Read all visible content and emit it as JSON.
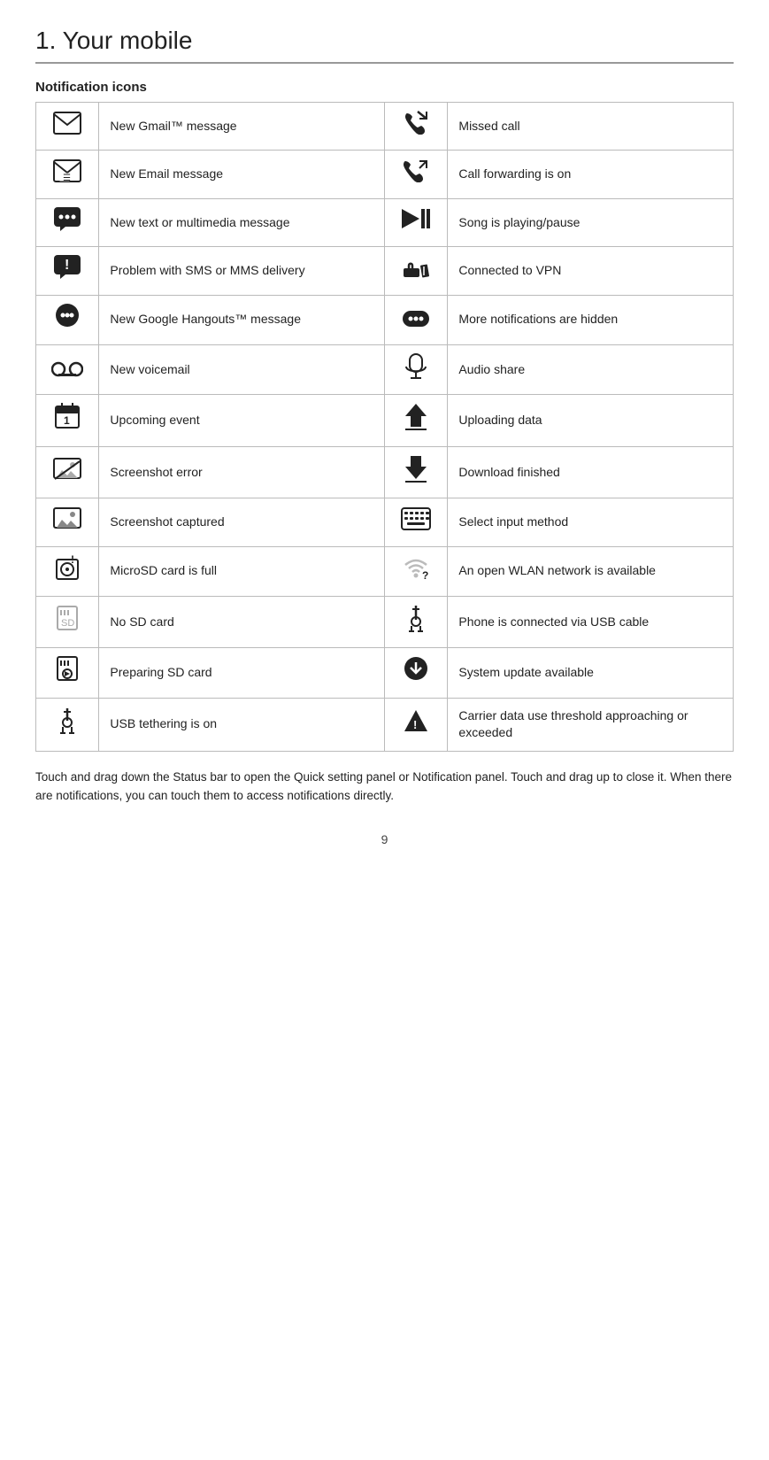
{
  "page": {
    "title": "1. Your mobile",
    "section": "Notification icons",
    "footer": "Touch and drag down the Status bar to open the Quick setting panel or Notification panel. Touch and drag up to close it. When there are notifications, you can touch them to access notifications directly.",
    "page_number": "9"
  },
  "rows": [
    {
      "left_icon": "gmail",
      "left_label": "New Gmail™ message",
      "right_icon": "missed_call",
      "right_label": "Missed call"
    },
    {
      "left_icon": "email",
      "left_label": "New Email message",
      "right_icon": "call_forward",
      "right_label": "Call forwarding is on"
    },
    {
      "left_icon": "sms",
      "left_label": "New text or multimedia message",
      "right_icon": "song",
      "right_label": "Song is playing/pause"
    },
    {
      "left_icon": "sms_error",
      "left_label": "Problem with SMS or MMS delivery",
      "right_icon": "vpn",
      "right_label": "Connected to VPN"
    },
    {
      "left_icon": "hangouts",
      "left_label": "New Google Hangouts™ message",
      "right_icon": "more_notif",
      "right_label": "More notifications are hidden"
    },
    {
      "left_icon": "voicemail",
      "left_label": "New voicemail",
      "right_icon": "audio_share",
      "right_label": "Audio share"
    },
    {
      "left_icon": "event",
      "left_label": "Upcoming event",
      "right_icon": "upload",
      "right_label": "Uploading data"
    },
    {
      "left_icon": "screenshot_error",
      "left_label": "Screenshot error",
      "right_icon": "download",
      "right_label": "Download finished"
    },
    {
      "left_icon": "screenshot",
      "left_label": "Screenshot captured",
      "right_icon": "input_method",
      "right_label": "Select input method"
    },
    {
      "left_icon": "microsd_full",
      "left_label": "MicroSD card is full",
      "right_icon": "wlan",
      "right_label": "An open WLAN network is available"
    },
    {
      "left_icon": "no_sd",
      "left_label": "No SD card",
      "right_icon": "usb",
      "right_label": "Phone is connected via USB cable"
    },
    {
      "left_icon": "preparing_sd",
      "left_label": "Preparing SD card",
      "right_icon": "system_update",
      "right_label": "System update available"
    },
    {
      "left_icon": "usb_tether",
      "left_label": "USB tethering is on",
      "right_icon": "carrier_data",
      "right_label": "Carrier data use threshold approaching or exceeded"
    }
  ]
}
